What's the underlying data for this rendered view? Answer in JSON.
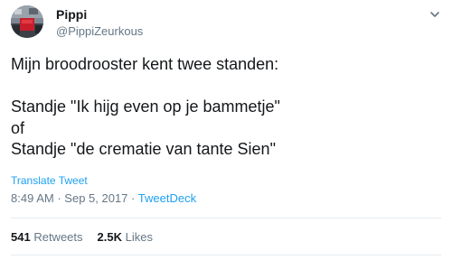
{
  "user": {
    "display_name": "Pippi",
    "handle": "@PippiZeurkous",
    "avatar": "profile-photo"
  },
  "tweet": {
    "lines": [
      "Mijn broodrooster kent twee standen:",
      "",
      "Standje \"Ik hijg even op je bammetje\"",
      "of",
      "Standje \"de crematie van tante Sien\""
    ],
    "translate_label": "Translate Tweet",
    "time": "8:49 AM",
    "date": "Sep 5, 2017",
    "separator": "·",
    "source": "TweetDeck"
  },
  "stats": {
    "retweets_count": "541",
    "retweets_label": "Retweets",
    "likes_count": "2.5K",
    "likes_label": "Likes"
  },
  "icons": {
    "menu": "chevron-down-icon"
  },
  "colors": {
    "text": "#14171a",
    "secondary": "#657786",
    "link": "#1da1f2",
    "divider": "#e6ecf0"
  }
}
